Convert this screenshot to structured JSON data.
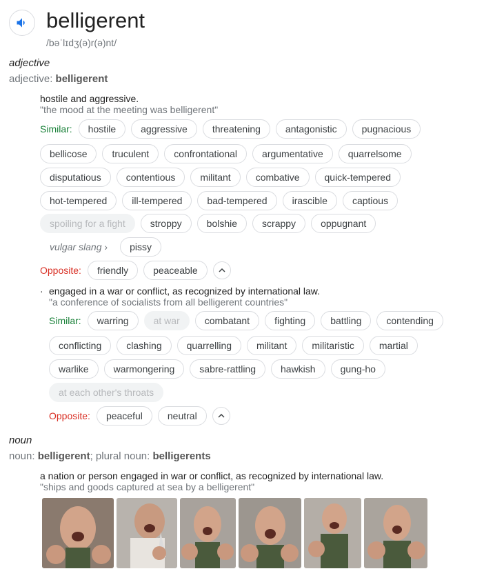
{
  "headword": "belligerent",
  "pronunciation": "/bəˈlɪdʒ(ə)r(ə)nt/",
  "adjective": {
    "pos_label": "adjective",
    "form_prefix": "adjective: ",
    "form_word": "belligerent",
    "sense1": {
      "definition": "hostile and aggressive.",
      "example": "\"the mood at the meeting was belligerent\"",
      "similar_label": "Similar:",
      "rows": [
        [
          "hostile",
          "aggressive",
          "threatening",
          "antagonistic",
          "pugnacious"
        ],
        [
          "bellicose",
          "truculent",
          "confrontational",
          "argumentative",
          "quarrelsome"
        ],
        [
          "disputatious",
          "contentious",
          "militant",
          "combative",
          "quick-tempered"
        ],
        [
          "hot-tempered",
          "ill-tempered",
          "bad-tempered",
          "irascible",
          "captious"
        ]
      ],
      "muted_chip": "spoiling for a fight",
      "row5": [
        "stroppy",
        "bolshie",
        "scrappy",
        "oppugnant"
      ],
      "vulgar_label": "vulgar slang",
      "vulgar_chips": [
        "pissy"
      ],
      "opposite_label": "Opposite:",
      "opposites": [
        "friendly",
        "peaceable"
      ]
    },
    "sense2": {
      "definition": "engaged in a war or conflict, as recognized by international law.",
      "example": "\"a conference of socialists from all belligerent countries\"",
      "similar_label": "Similar:",
      "row1_a": [
        "warring"
      ],
      "row1_muted": "at war",
      "row1_b": [
        "combatant",
        "fighting",
        "battling",
        "contending"
      ],
      "rows": [
        [
          "conflicting",
          "clashing",
          "quarrelling",
          "militant",
          "militaristic",
          "martial"
        ],
        [
          "warlike",
          "warmongering",
          "sabre-rattling",
          "hawkish",
          "gung-ho"
        ]
      ],
      "muted_chip": "at each other's throats",
      "opposite_label": "Opposite:",
      "opposites": [
        "peaceful",
        "neutral"
      ]
    }
  },
  "noun": {
    "pos_label": "noun",
    "form_prefix": "noun: ",
    "form_word": "belligerent",
    "plural_prefix": "; plural noun: ",
    "plural_word": "belligerents",
    "definition": "a nation or person engaged in war or conflict, as recognized by international law.",
    "example": "\"ships and goods captured at sea by a belligerent\""
  },
  "colors": {
    "similar": "#188038",
    "opposite": "#d93025",
    "speaker_icon": "#1a73e8"
  },
  "icons": {
    "speaker": "volume-icon",
    "collapse": "chevron-up-icon",
    "vulgar_more": "chevron-right-icon"
  }
}
